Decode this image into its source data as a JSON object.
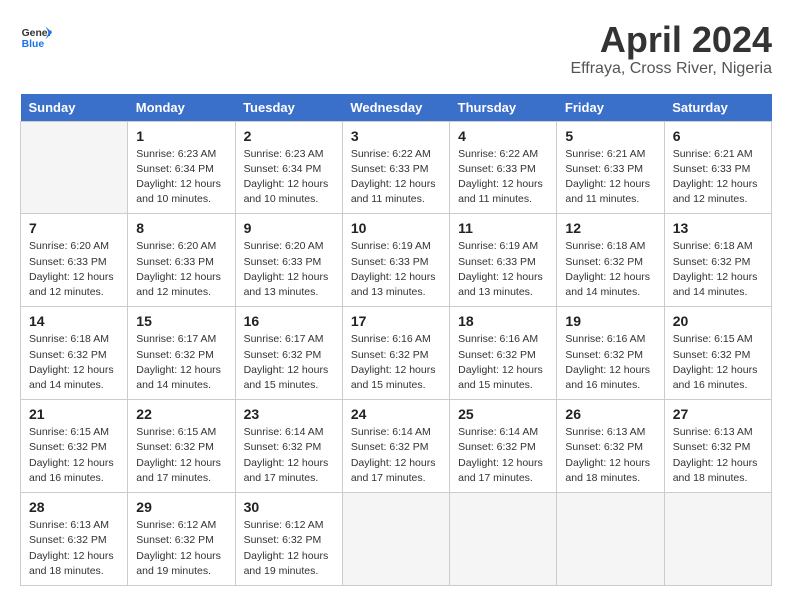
{
  "header": {
    "logo_line1": "General",
    "logo_line2": "Blue",
    "month": "April 2024",
    "location": "Effraya, Cross River, Nigeria"
  },
  "weekdays": [
    "Sunday",
    "Monday",
    "Tuesday",
    "Wednesday",
    "Thursday",
    "Friday",
    "Saturday"
  ],
  "weeks": [
    [
      {
        "day": null
      },
      {
        "day": "1",
        "sunrise": "6:23 AM",
        "sunset": "6:34 PM",
        "daylight": "12 hours and 10 minutes."
      },
      {
        "day": "2",
        "sunrise": "6:23 AM",
        "sunset": "6:34 PM",
        "daylight": "12 hours and 10 minutes."
      },
      {
        "day": "3",
        "sunrise": "6:22 AM",
        "sunset": "6:33 PM",
        "daylight": "12 hours and 11 minutes."
      },
      {
        "day": "4",
        "sunrise": "6:22 AM",
        "sunset": "6:33 PM",
        "daylight": "12 hours and 11 minutes."
      },
      {
        "day": "5",
        "sunrise": "6:21 AM",
        "sunset": "6:33 PM",
        "daylight": "12 hours and 11 minutes."
      },
      {
        "day": "6",
        "sunrise": "6:21 AM",
        "sunset": "6:33 PM",
        "daylight": "12 hours and 12 minutes."
      }
    ],
    [
      {
        "day": "7",
        "sunrise": "6:20 AM",
        "sunset": "6:33 PM",
        "daylight": "12 hours and 12 minutes."
      },
      {
        "day": "8",
        "sunrise": "6:20 AM",
        "sunset": "6:33 PM",
        "daylight": "12 hours and 12 minutes."
      },
      {
        "day": "9",
        "sunrise": "6:20 AM",
        "sunset": "6:33 PM",
        "daylight": "12 hours and 13 minutes."
      },
      {
        "day": "10",
        "sunrise": "6:19 AM",
        "sunset": "6:33 PM",
        "daylight": "12 hours and 13 minutes."
      },
      {
        "day": "11",
        "sunrise": "6:19 AM",
        "sunset": "6:33 PM",
        "daylight": "12 hours and 13 minutes."
      },
      {
        "day": "12",
        "sunrise": "6:18 AM",
        "sunset": "6:32 PM",
        "daylight": "12 hours and 14 minutes."
      },
      {
        "day": "13",
        "sunrise": "6:18 AM",
        "sunset": "6:32 PM",
        "daylight": "12 hours and 14 minutes."
      }
    ],
    [
      {
        "day": "14",
        "sunrise": "6:18 AM",
        "sunset": "6:32 PM",
        "daylight": "12 hours and 14 minutes."
      },
      {
        "day": "15",
        "sunrise": "6:17 AM",
        "sunset": "6:32 PM",
        "daylight": "12 hours and 14 minutes."
      },
      {
        "day": "16",
        "sunrise": "6:17 AM",
        "sunset": "6:32 PM",
        "daylight": "12 hours and 15 minutes."
      },
      {
        "day": "17",
        "sunrise": "6:16 AM",
        "sunset": "6:32 PM",
        "daylight": "12 hours and 15 minutes."
      },
      {
        "day": "18",
        "sunrise": "6:16 AM",
        "sunset": "6:32 PM",
        "daylight": "12 hours and 15 minutes."
      },
      {
        "day": "19",
        "sunrise": "6:16 AM",
        "sunset": "6:32 PM",
        "daylight": "12 hours and 16 minutes."
      },
      {
        "day": "20",
        "sunrise": "6:15 AM",
        "sunset": "6:32 PM",
        "daylight": "12 hours and 16 minutes."
      }
    ],
    [
      {
        "day": "21",
        "sunrise": "6:15 AM",
        "sunset": "6:32 PM",
        "daylight": "12 hours and 16 minutes."
      },
      {
        "day": "22",
        "sunrise": "6:15 AM",
        "sunset": "6:32 PM",
        "daylight": "12 hours and 17 minutes."
      },
      {
        "day": "23",
        "sunrise": "6:14 AM",
        "sunset": "6:32 PM",
        "daylight": "12 hours and 17 minutes."
      },
      {
        "day": "24",
        "sunrise": "6:14 AM",
        "sunset": "6:32 PM",
        "daylight": "12 hours and 17 minutes."
      },
      {
        "day": "25",
        "sunrise": "6:14 AM",
        "sunset": "6:32 PM",
        "daylight": "12 hours and 17 minutes."
      },
      {
        "day": "26",
        "sunrise": "6:13 AM",
        "sunset": "6:32 PM",
        "daylight": "12 hours and 18 minutes."
      },
      {
        "day": "27",
        "sunrise": "6:13 AM",
        "sunset": "6:32 PM",
        "daylight": "12 hours and 18 minutes."
      }
    ],
    [
      {
        "day": "28",
        "sunrise": "6:13 AM",
        "sunset": "6:32 PM",
        "daylight": "12 hours and 18 minutes."
      },
      {
        "day": "29",
        "sunrise": "6:12 AM",
        "sunset": "6:32 PM",
        "daylight": "12 hours and 19 minutes."
      },
      {
        "day": "30",
        "sunrise": "6:12 AM",
        "sunset": "6:32 PM",
        "daylight": "12 hours and 19 minutes."
      },
      {
        "day": null
      },
      {
        "day": null
      },
      {
        "day": null
      },
      {
        "day": null
      }
    ]
  ],
  "labels": {
    "sunrise": "Sunrise:",
    "sunset": "Sunset:",
    "daylight": "Daylight:"
  }
}
